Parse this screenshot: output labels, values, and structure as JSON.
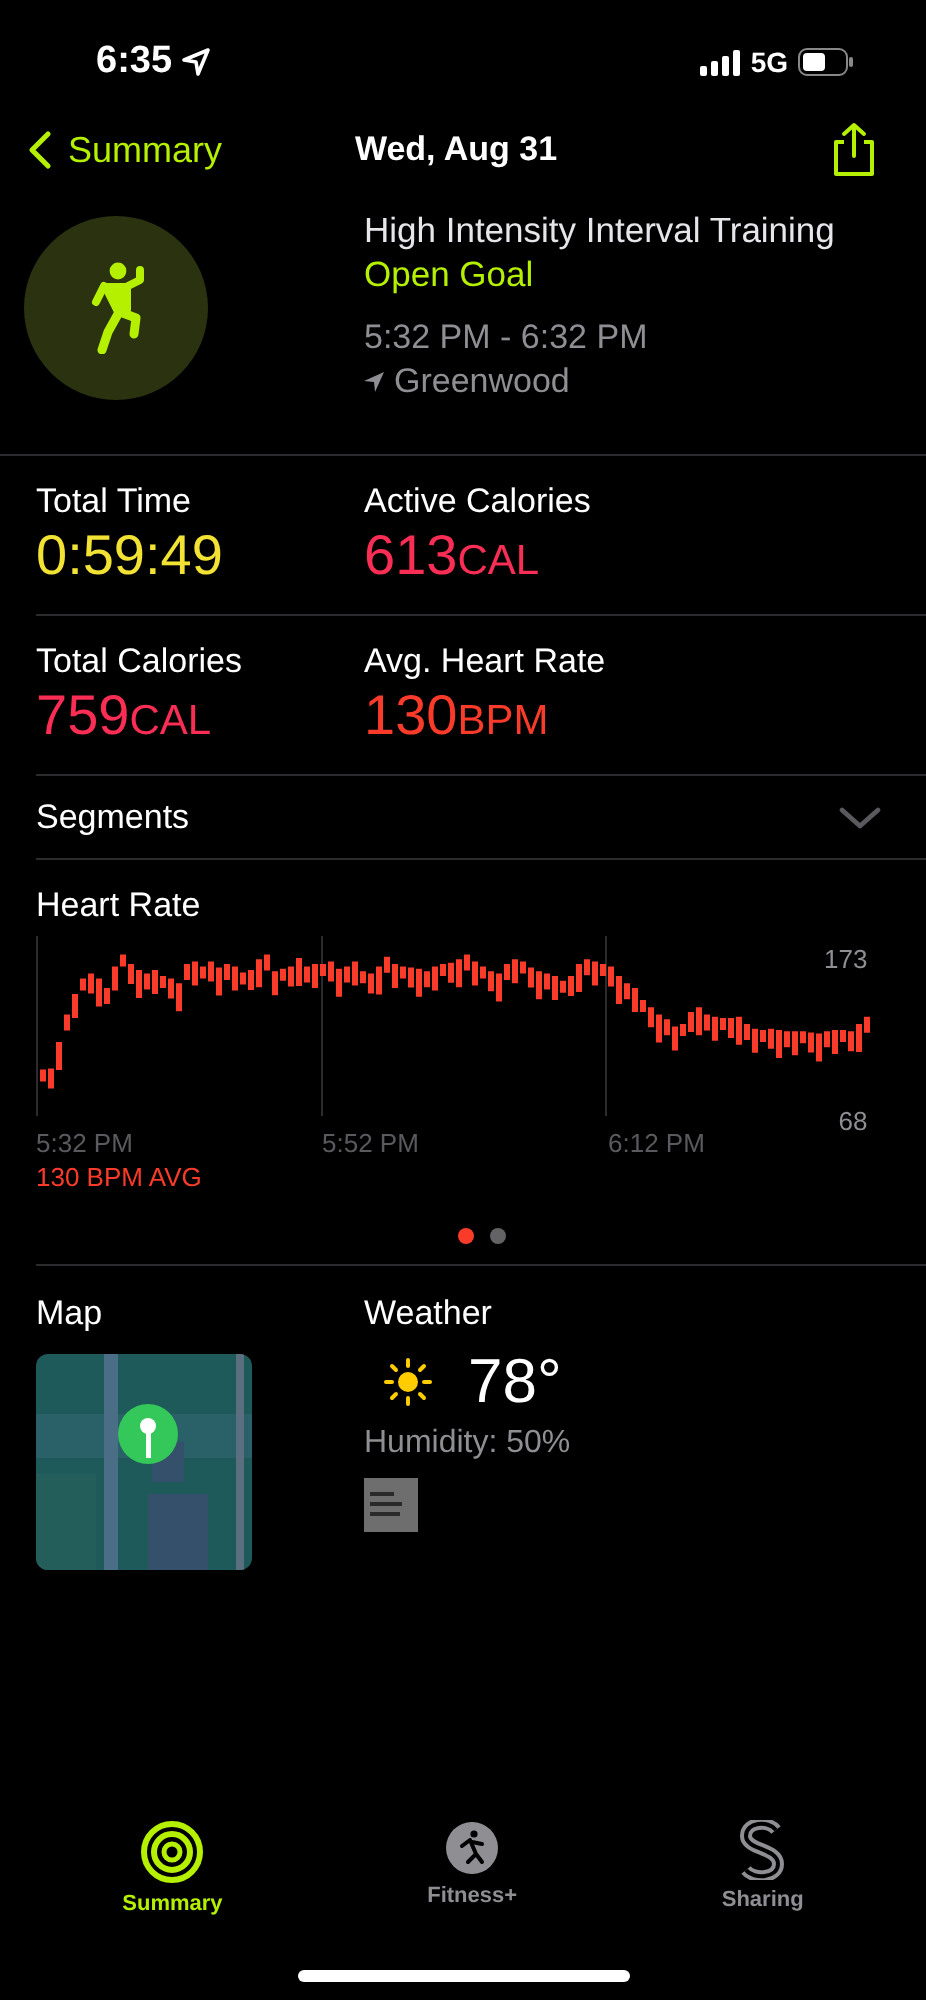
{
  "status_bar": {
    "time": "6:35",
    "network": "5G"
  },
  "nav": {
    "back": "Summary",
    "title": "Wed, Aug 31"
  },
  "workout": {
    "name": "High Intensity Interval Training",
    "goal": "Open Goal",
    "time_range": "5:32 PM - 6:32 PM",
    "location": "Greenwood"
  },
  "stats": [
    {
      "label": "Total Time",
      "value": "0:59:49",
      "color": "#f2e234"
    },
    {
      "label": "Active Calories",
      "value": "613",
      "unit": "CAL",
      "color": "#fa2d55"
    },
    {
      "label": "Total Calories",
      "value": "759",
      "unit": "CAL",
      "color": "#fa2d55"
    },
    {
      "label": "Avg. Heart Rate",
      "value": "130",
      "unit": "BPM",
      "color": "#fa3b2a"
    }
  ],
  "segments": {
    "label": "Segments",
    "expanded": false
  },
  "heart_rate": {
    "title": "Heart Rate",
    "y_max": "173",
    "y_min": "68",
    "times": [
      "5:32 PM",
      "5:52 PM",
      "6:12 PM"
    ],
    "average": "130 BPM AVG"
  },
  "pages": [
    {
      "selected": true
    },
    {
      "selected": false
    }
  ],
  "map": {
    "title": "Map"
  },
  "weather": {
    "title": "Weather",
    "temperature": "78°",
    "humidity": "Humidity: 50%"
  },
  "tabs": [
    {
      "label": "Summary",
      "selected": true
    },
    {
      "label": "Fitness+",
      "selected": false
    },
    {
      "label": "Sharing",
      "selected": false
    }
  ]
}
